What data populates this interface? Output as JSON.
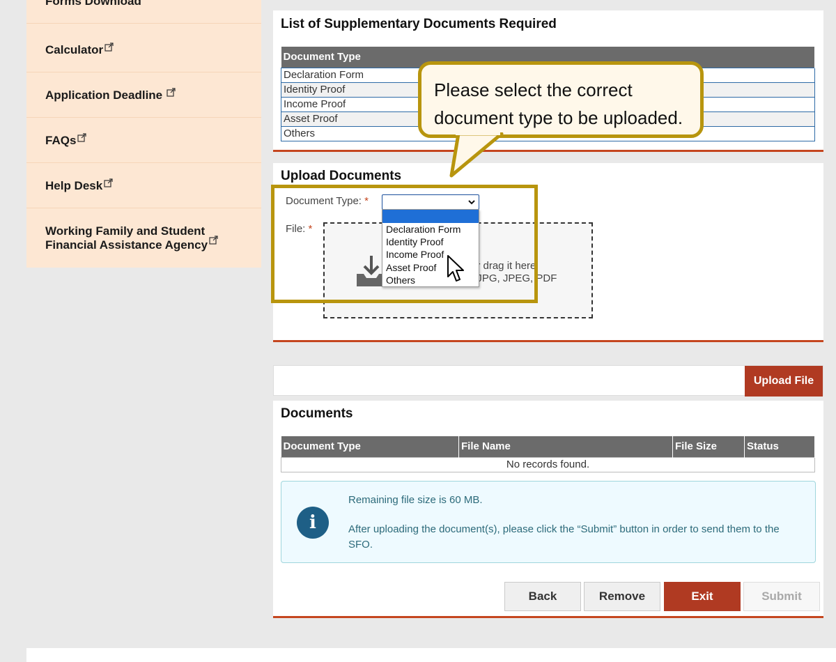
{
  "sidebar": {
    "items": [
      {
        "label": "Forms Download",
        "external": false
      },
      {
        "label": "Calculator",
        "external": true
      },
      {
        "label": "Application Deadline",
        "external": true
      },
      {
        "label": "FAQs",
        "external": true
      },
      {
        "label": "Help Desk",
        "external": true
      },
      {
        "label_line1": "Working Family and Student",
        "label_line2": "Financial Assistance Agency",
        "external": true
      }
    ]
  },
  "supplementary": {
    "title": "List of Supplementary Documents Required",
    "column_header": "Document Type",
    "rows": [
      "Declaration Form",
      "Identity Proof",
      "Income Proof",
      "Asset Proof",
      "Others"
    ]
  },
  "callout": {
    "text": "Please select the correct document type to be uploaded."
  },
  "upload": {
    "title": "Upload Documents",
    "document_type_label": "Document Type:",
    "file_label": "File:",
    "required_mark": "*",
    "selected_value": "",
    "dropdown_options": [
      "",
      "Declaration Form",
      "Identity Proof",
      "Income Proof",
      "Asset Proof",
      "Others"
    ],
    "dropzone_text_line1": "or drag it here",
    "dropzone_text_line2": ": JPG, JPEG, PDF"
  },
  "upload_bar": {
    "button_label": "Upload File"
  },
  "documents": {
    "title": "Documents",
    "columns": [
      "Document Type",
      "File Name",
      "File Size",
      "Status"
    ],
    "empty_text": "No records found.",
    "info_line1": "Remaining file size is 60 MB.",
    "info_line2": "After uploading the document(s), please click the “Submit” button in order to send them to the SFO.",
    "info_icon": "info-icon"
  },
  "actions": {
    "back": "Back",
    "remove": "Remove",
    "exit": "Exit",
    "submit": "Submit"
  },
  "colors": {
    "accent": "#b03a22",
    "highlight": "#b8950e",
    "sidebar_bg": "#fde7d3",
    "table_header": "#6b6b6b"
  }
}
